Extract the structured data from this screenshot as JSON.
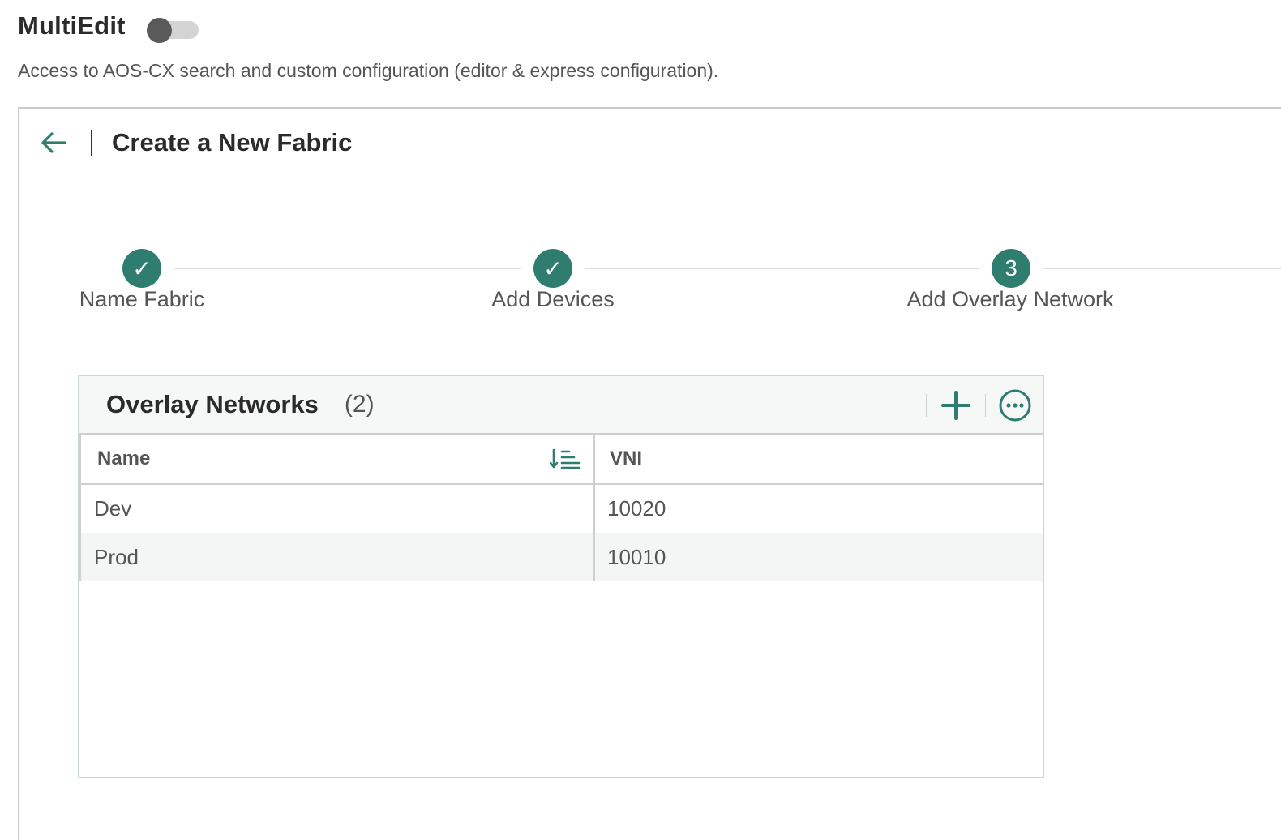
{
  "multiedit": {
    "label": "MultiEdit",
    "enabled": false,
    "description": "Access to AOS-CX search and custom configuration (editor & express configuration)."
  },
  "page": {
    "title": "Create a New Fabric",
    "back_icon": "arrow-left-icon"
  },
  "stepper": {
    "steps": [
      {
        "label": "Name Fabric",
        "status": "complete",
        "marker": "✓"
      },
      {
        "label": "Add Devices",
        "status": "complete",
        "marker": "✓"
      },
      {
        "label": "Add Overlay Network",
        "status": "current",
        "marker": "3"
      }
    ]
  },
  "overlay_table": {
    "title": "Overlay Networks",
    "count": "(2)",
    "actions": [
      "plus-icon",
      "more-options-icon"
    ],
    "columns": [
      "Name",
      "VNI"
    ],
    "sort_icon": "sort-ascending-icon",
    "rows": [
      {
        "name": "Dev",
        "vni": "10020"
      },
      {
        "name": "Prod",
        "vni": "10010"
      }
    ]
  },
  "colors": {
    "accent": "#2f7d6f",
    "toggle_off_knob": "#5a5a5a",
    "toggle_off_track": "#d4d4d4"
  }
}
